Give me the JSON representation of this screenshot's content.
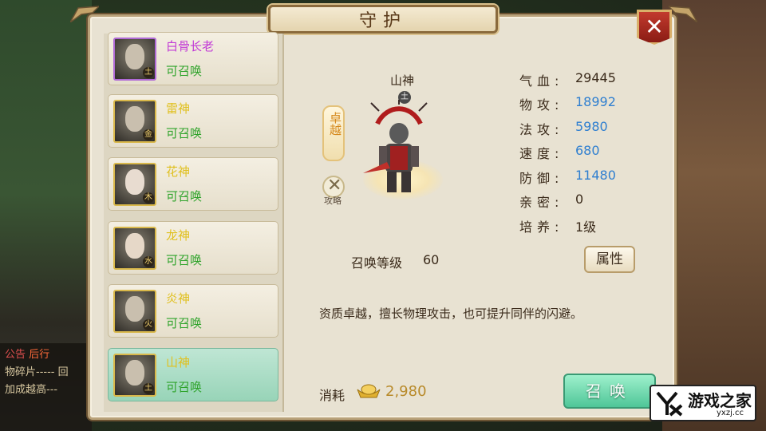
{
  "window": {
    "title": "守护"
  },
  "list": [
    {
      "name": "白骨长老",
      "status": "可召唤",
      "element": "土",
      "name_color": "#c23ad6",
      "selected": false
    },
    {
      "name": "雷神",
      "status": "可召唤",
      "element": "金",
      "name_color": "#e0c020",
      "selected": false
    },
    {
      "name": "花神",
      "status": "可召唤",
      "element": "木",
      "name_color": "#e0c020",
      "selected": false
    },
    {
      "name": "龙神",
      "status": "可召唤",
      "element": "水",
      "name_color": "#e0c020",
      "selected": false
    },
    {
      "name": "炎神",
      "status": "可召唤",
      "element": "火",
      "name_color": "#e0c020",
      "selected": false
    },
    {
      "name": "山神",
      "status": "可召唤",
      "element": "土",
      "name_color": "#e0c020",
      "selected": true
    }
  ],
  "detail": {
    "name": "山神",
    "element": "土",
    "quality": "卓越",
    "guide_label": "攻略",
    "stats": [
      {
        "label": "气血:",
        "value": "29445",
        "color": "dark"
      },
      {
        "label": "物攻:",
        "value": "18992",
        "color": "blue"
      },
      {
        "label": "法攻:",
        "value": "5980",
        "color": "blue"
      },
      {
        "label": "速度:",
        "value": "680",
        "color": "blue"
      },
      {
        "label": "防御:",
        "value": "11480",
        "color": "blue"
      },
      {
        "label": "亲密:",
        "value": "0",
        "color": "dark"
      },
      {
        "label": "培养:",
        "value": "1级",
        "color": "dark"
      }
    ],
    "attr_button": "属性",
    "summon_level_label": "召唤等级",
    "summon_level": "60",
    "description": "资质卓越，擅长物理攻击，也可提升同伴的闪避。",
    "cost_label": "消耗",
    "cost_value": "2,980",
    "summon_button": "召唤"
  },
  "background": {
    "chat_lines": [
      "公告",
      "后行",
      "物碎片----- 回",
      "加成越高---"
    ]
  },
  "watermark": {
    "site": "游戏之家",
    "url": "yxzj.cc"
  }
}
